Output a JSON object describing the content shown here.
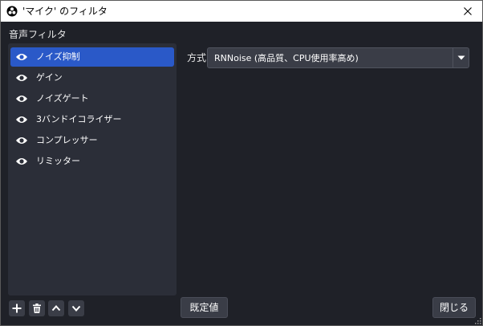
{
  "window": {
    "title": "'マイク' のフィルタ",
    "close_icon": "close-icon",
    "app_icon": "obs-logo-icon"
  },
  "filters": {
    "section_label": "音声フィルタ",
    "items": [
      {
        "label": "ノイズ抑制",
        "selected": true,
        "icon": "eye-icon"
      },
      {
        "label": "ゲイン",
        "selected": false,
        "icon": "eye-icon"
      },
      {
        "label": "ノイズゲート",
        "selected": false,
        "icon": "eye-icon"
      },
      {
        "label": "3バンドイコライザー",
        "selected": false,
        "icon": "eye-icon"
      },
      {
        "label": "コンプレッサー",
        "selected": false,
        "icon": "eye-icon"
      },
      {
        "label": "リミッター",
        "selected": false,
        "icon": "eye-icon"
      }
    ],
    "toolbar": {
      "add_icon": "plus-icon",
      "remove_icon": "trash-icon",
      "up_icon": "chevron-up-icon",
      "down_icon": "chevron-down-icon"
    }
  },
  "properties": {
    "method_label": "方式",
    "method_value": "RNNoise (高品質、CPU使用率高め)"
  },
  "buttons": {
    "defaults": "既定値",
    "close": "閉じる"
  },
  "colors": {
    "background": "#1f2128",
    "panel": "#2b2e38",
    "selected": "#2a59c8",
    "control": "#3a3d47"
  }
}
